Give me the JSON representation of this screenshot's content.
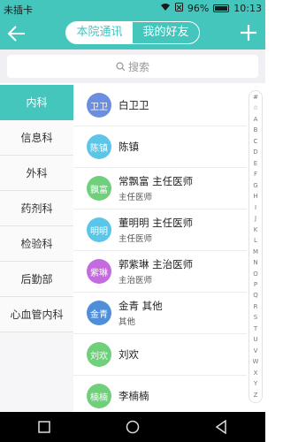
{
  "status": {
    "carrier": "未插卡",
    "battery": "96%",
    "time": "10:13"
  },
  "header": {
    "tabs": [
      {
        "label": "本院通讯",
        "active": true
      },
      {
        "label": "我的好友",
        "active": false
      }
    ]
  },
  "search": {
    "placeholder": "搜索"
  },
  "categories": [
    "内科",
    "信息科",
    "外科",
    "药剂科",
    "检验科",
    "后勤部",
    "心血管内科"
  ],
  "contacts": [
    {
      "avatar": "卫卫",
      "name": "白卫卫",
      "title": "",
      "color": "#6a8fe0"
    },
    {
      "avatar": "陈镇",
      "name": "陈镇",
      "title": "",
      "color": "#5cc6e8"
    },
    {
      "avatar": "飘富",
      "name": "常飘富  主任医师",
      "title": "主任医师",
      "color": "#6fcf7a"
    },
    {
      "avatar": "明明",
      "name": "董明明  主任医师",
      "title": "主任医师",
      "color": "#5cc6e8"
    },
    {
      "avatar": "紫琳",
      "name": "郭紫琳  主治医师",
      "title": "主治医师",
      "color": "#c46be0"
    },
    {
      "avatar": "金青",
      "name": "金青  其他",
      "title": "其他",
      "color": "#4f8ed8"
    },
    {
      "avatar": "刘欢",
      "name": "刘欢",
      "title": "",
      "color": "#6fcf7a"
    },
    {
      "avatar": "楠楠",
      "name": "李楠楠",
      "title": "",
      "color": "#6fcf7a"
    }
  ],
  "index_letters": [
    "#",
    "☆",
    "A",
    "B",
    "C",
    "D",
    "E",
    "F",
    "G",
    "H",
    "I",
    "J",
    "K",
    "L",
    "M",
    "N",
    "O",
    "P",
    "Q",
    "R",
    "S",
    "T",
    "U",
    "V",
    "W",
    "X",
    "Y",
    "Z"
  ],
  "colors": {
    "accent": "#45c6bd"
  }
}
